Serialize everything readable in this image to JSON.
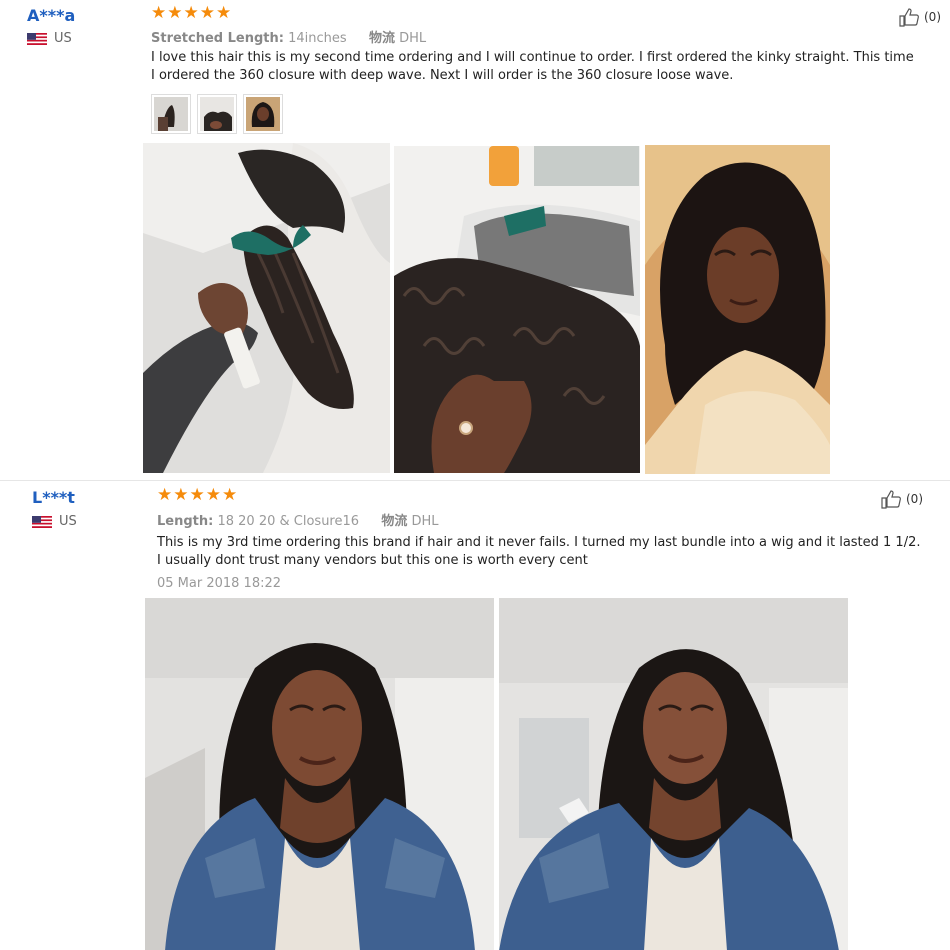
{
  "reviews": [
    {
      "user": {
        "name": "A***a",
        "country": "US"
      },
      "rating": 5,
      "specs": {
        "length_label": "Stretched Length:",
        "length_value": "14inches",
        "shipping_label": "物流",
        "shipping_value": "DHL"
      },
      "text": "I love this hair this is my second time ordering and I will continue to order. I first ordered the kinky straight. This time I ordered the 360 closure with deep wave. Next I will order is the 360 closure loose wave.",
      "helpful_count": "(0)",
      "photo_icons": [
        "photo-icon",
        "photo-icon",
        "photo-icon"
      ]
    },
    {
      "user": {
        "name": "L***t",
        "country": "US"
      },
      "rating": 5,
      "specs": {
        "length_label": "Length:",
        "length_value": "18 20 20 & Closure16",
        "shipping_label": "物流",
        "shipping_value": "DHL"
      },
      "text": "This is my 3rd time ordering this brand if hair and it never fails. I turned my last bundle into a wig and it lasted 1 1/2. I usually dont trust many vendors but this one is worth every cent",
      "date": "05 Mar 2018 18:22",
      "helpful_count": "(0)"
    }
  ],
  "colors": {
    "star": "#f58b0b",
    "username": "#1f5fbf",
    "muted": "#999999"
  },
  "icons": {
    "thumbs_up": "thumbs-up-icon",
    "flag": "us-flag-icon",
    "star": "star-icon"
  }
}
